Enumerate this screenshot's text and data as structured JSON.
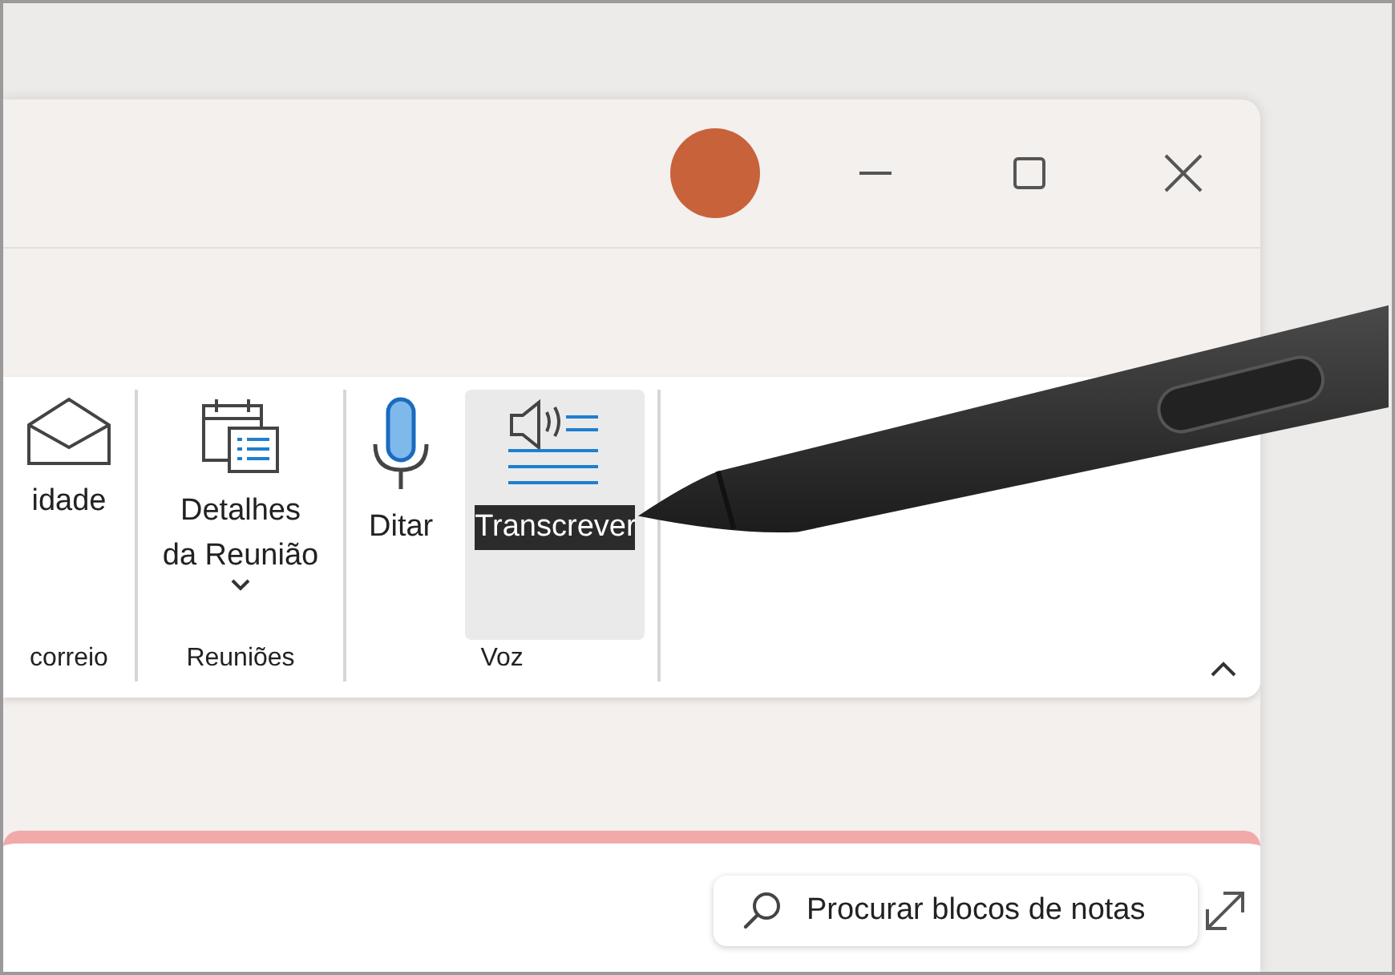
{
  "title_bar": {
    "controls": [
      {
        "kind": "minimize"
      },
      {
        "kind": "maximize"
      },
      {
        "kind": "close"
      }
    ]
  },
  "ribbon": {
    "groups": [
      {
        "label": "correio",
        "buttons": [
          {
            "kind": "envelope",
            "label": "idade",
            "selected": false
          }
        ]
      },
      {
        "label": "Reuniões",
        "buttons": [
          {
            "kind": "calendar",
            "label": "Detalhes da Reunião",
            "selected": false,
            "dropdown": true
          }
        ]
      },
      {
        "label": "Voz",
        "buttons": [
          {
            "kind": "microphone",
            "label": "Ditar",
            "selected": false
          },
          {
            "kind": "transcribe",
            "label": "Transcrever",
            "selected": true
          }
        ]
      }
    ]
  },
  "search": {
    "placeholder": "Procurar blocos de notas"
  }
}
